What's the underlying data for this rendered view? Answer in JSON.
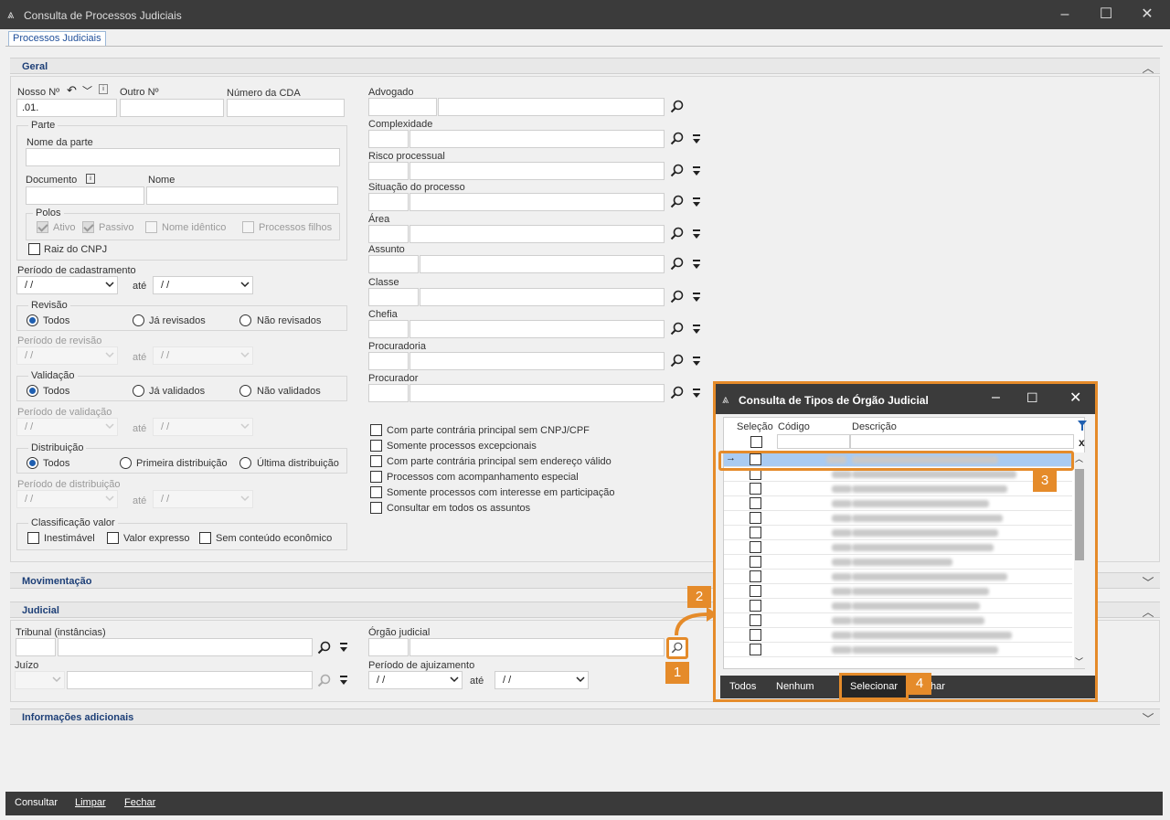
{
  "window": {
    "title": "Consulta de Processos Judiciais",
    "tab": "Processos Judiciais"
  },
  "sections": {
    "geral": "Geral",
    "movimentacao": "Movimentação",
    "judicial": "Judicial",
    "info": "Informações adicionais"
  },
  "geral": {
    "nosso_no_label": "Nosso Nº",
    "nosso_no_value": ".01.",
    "outro_no_label": "Outro Nº",
    "cda_label": "Número da CDA",
    "parte_legend": "Parte",
    "nome_parte_label": "Nome da parte",
    "documento_label": "Documento",
    "nome_label": "Nome",
    "polos_legend": "Polos",
    "ativo": "Ativo",
    "passivo": "Passivo",
    "nome_identico": "Nome idêntico",
    "processos_filhos": "Processos filhos",
    "raiz_cnpj": "Raiz do CNPJ",
    "periodo_cad_label": "Período de cadastramento",
    "date_placeholder": "/ /",
    "ate": "até",
    "revisao_legend": "Revisão",
    "todos": "Todos",
    "ja_revisados": "Já revisados",
    "nao_revisados": "Não revisados",
    "periodo_rev_label": "Período de revisão",
    "validacao_legend": "Validação",
    "ja_validados": "Já validados",
    "nao_validados": "Não validados",
    "periodo_val_label": "Período de validação",
    "distribuicao_legend": "Distribuição",
    "primeira_dist": "Primeira distribuição",
    "ultima_dist": "Última distribuição",
    "periodo_dist_label": "Período de distribuição",
    "classificacao_legend": "Classificação valor",
    "inestimavel": "Inestimável",
    "valor_expresso": "Valor expresso",
    "sem_conteudo": "Sem conteúdo econômico",
    "right_fields": [
      "Advogado",
      "Complexidade",
      "Risco processual",
      "Situação do processo",
      "Área",
      "Assunto",
      "Classe",
      "Chefia",
      "Procuradoria",
      "Procurador"
    ],
    "checks": [
      "Com parte contrária principal sem CNPJ/CPF",
      "Somente processos excepcionais",
      "Com parte contrária principal sem endereço válido",
      "Processos com acompanhamento especial",
      "Somente processos com interesse em participação",
      "Consultar em todos os assuntos"
    ]
  },
  "judicial": {
    "tribunal_label": "Tribunal (instâncias)",
    "orgao_label": "Órgão judicial",
    "juizo_label": "Juízo",
    "periodo_aj_label": "Período de ajuizamento"
  },
  "footer": {
    "consultar": "Consultar",
    "limpar": "Limpar",
    "fechar": "Fechar"
  },
  "popup": {
    "title": "Consulta de Tipos de Órgão Judicial",
    "col_selecao": "Seleção",
    "col_codigo": "Código",
    "col_descricao": "Descrição",
    "clear_filter": "x",
    "todos": "Todos",
    "nenhum": "Nenhum",
    "selecionar": "Selecionar",
    "fechar_partial": "har"
  },
  "annotations": [
    "1",
    "2",
    "3",
    "4"
  ],
  "colors": {
    "accent": "#e58b2a",
    "title_bar": "#3b3b3b",
    "selected_row": "#a9cbf2",
    "section_text": "#1d3f77"
  }
}
